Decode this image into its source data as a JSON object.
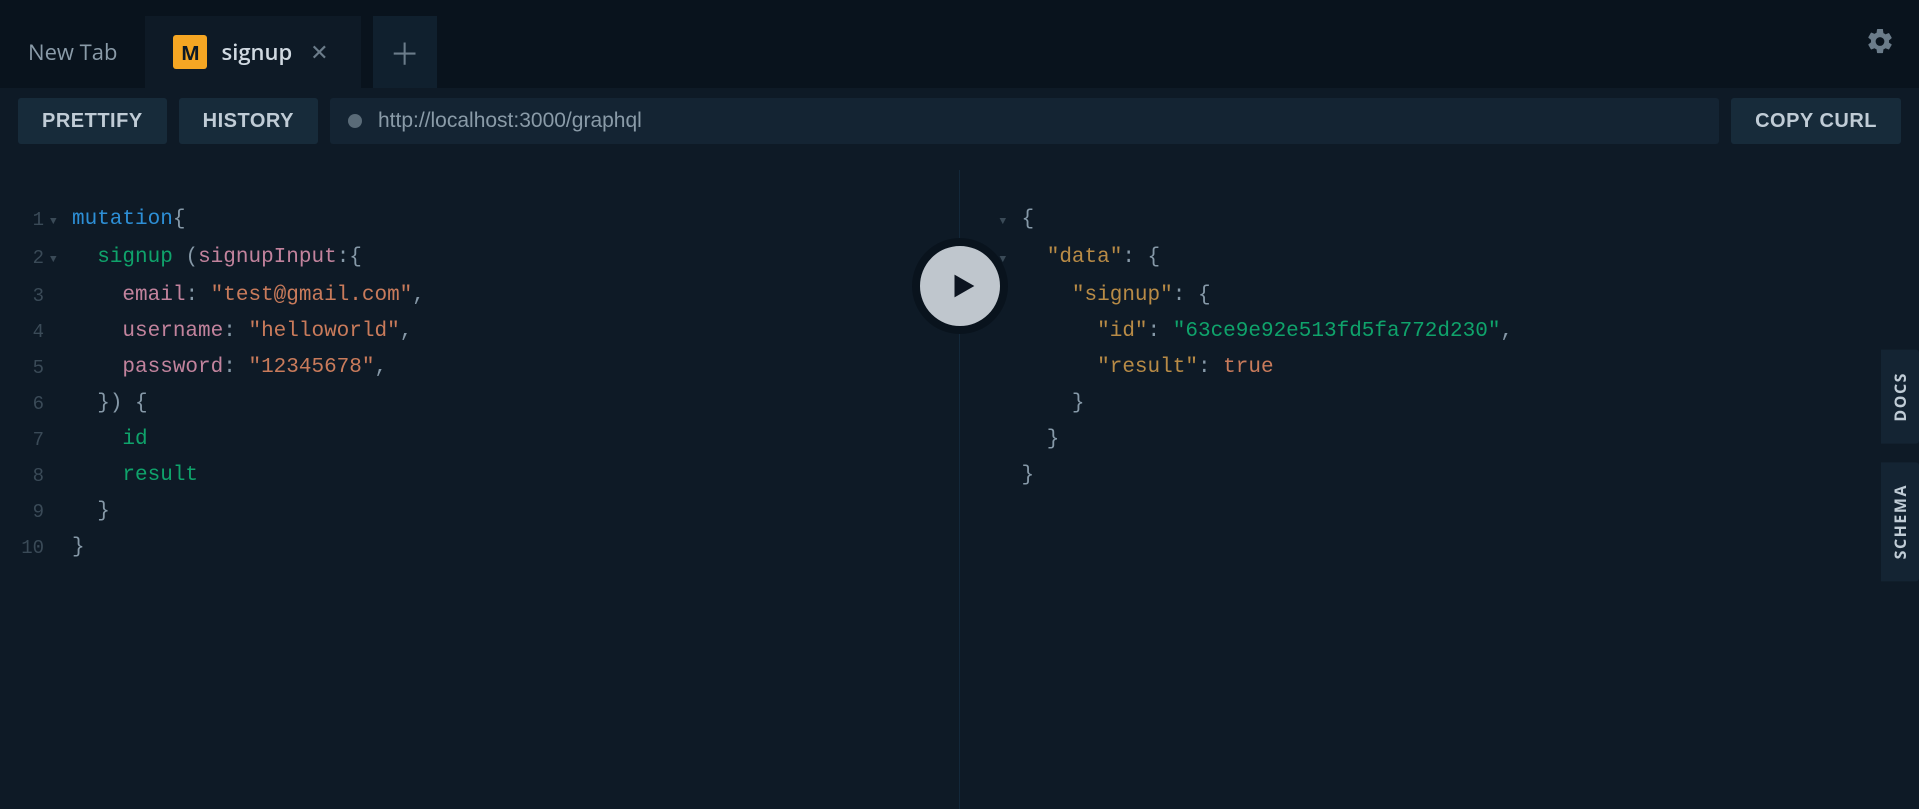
{
  "tabs": {
    "new_tab_label": "New Tab",
    "active": {
      "badge": "M",
      "label": "signup"
    }
  },
  "toolbar": {
    "prettify": "PRETTIFY",
    "history": "HISTORY",
    "url": "http://localhost:3000/graphql",
    "copy_curl": "COPY CURL"
  },
  "side": {
    "docs": "DOCS",
    "schema": "SCHEMA"
  },
  "query": {
    "keyword": "mutation",
    "operation": "signup",
    "input_arg": "signupInput",
    "fields": {
      "email_key": "email",
      "email_val": "\"test@gmail.com\"",
      "username_key": "username",
      "username_val": "\"helloworld\"",
      "password_key": "password",
      "password_val": "\"12345678\""
    },
    "selection": {
      "id": "id",
      "result": "result"
    },
    "linenos": [
      "1",
      "2",
      "3",
      "4",
      "5",
      "6",
      "7",
      "8",
      "9",
      "10"
    ]
  },
  "response": {
    "data_key": "\"data\"",
    "signup_key": "\"signup\"",
    "id_key": "\"id\"",
    "id_val": "\"63ce9e92e513fd5fa772d230\"",
    "result_key": "\"result\"",
    "result_val": "true"
  }
}
